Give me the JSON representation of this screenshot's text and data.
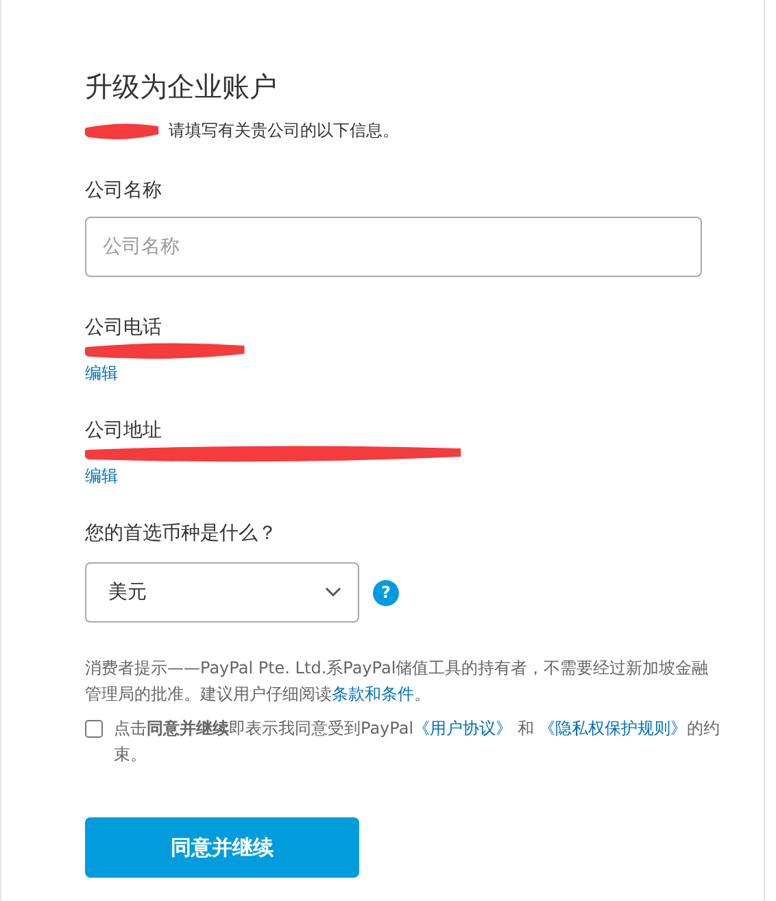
{
  "title": "升级为企业账户",
  "intro": {
    "text": "请填写有关贵公司的以下信息。"
  },
  "company_name": {
    "label": "公司名称",
    "placeholder": "公司名称"
  },
  "company_phone": {
    "label": "公司电话",
    "edit": "编辑"
  },
  "company_address": {
    "label": "公司地址",
    "edit": "编辑"
  },
  "currency": {
    "label": "您的首选币种是什么？",
    "value": "美元",
    "help": "?"
  },
  "notice": {
    "text": "消费者提示——PayPal Pte. Ltd.系PayPal储值工具的持有者，不需要经过新加坡金融管理局的批准。建议用户仔细阅读",
    "link": "条款和条件",
    "end": "。"
  },
  "consent": {
    "checked": false,
    "before": "点击**同意并继续**即表示我同意受到PayPal",
    "link1": "《用户协议》",
    "middle": " 和 ",
    "link2": "《隐私权保护规则》",
    "after": "的约束。"
  },
  "submit": "同意并继续"
}
